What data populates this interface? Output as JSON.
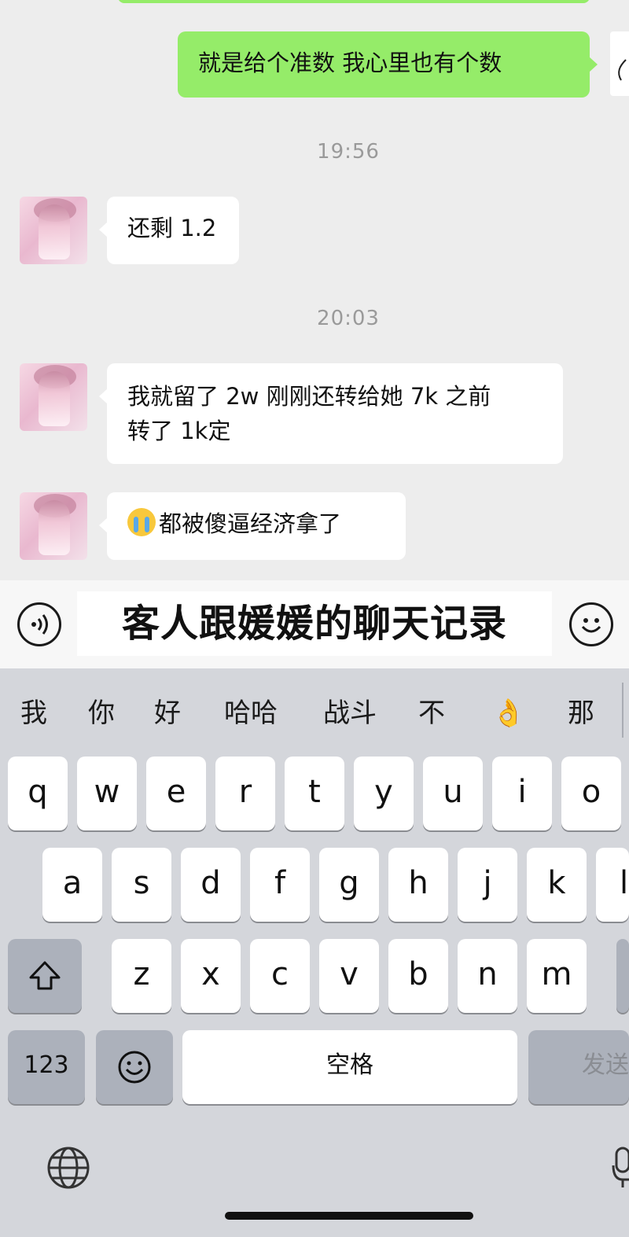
{
  "chat": {
    "messages": [
      {
        "side": "right",
        "text": "就是给个准数 我心里也有个数"
      },
      {
        "type": "time",
        "text": "19:56"
      },
      {
        "side": "left",
        "text": "还剩 1.2"
      },
      {
        "type": "time",
        "text": "20:03"
      },
      {
        "side": "left",
        "text_line1": "我就留了 2w 刚刚还转给她 7k 之前",
        "text_line2": "转了 1k定"
      },
      {
        "side": "left",
        "emoji": "loudly-crying-face",
        "text": "都被傻逼经济拿了"
      }
    ]
  },
  "input_bar": {
    "caption": "客人跟媛媛的聊天记录"
  },
  "keyboard": {
    "candidates": [
      "我",
      "你",
      "好",
      "哈哈",
      "战斗",
      "不",
      "👌",
      "那"
    ],
    "row1": [
      "q",
      "w",
      "e",
      "r",
      "t",
      "y",
      "u",
      "i",
      "o"
    ],
    "row2": [
      "a",
      "s",
      "d",
      "f",
      "g",
      "h",
      "j",
      "k",
      "l"
    ],
    "row3": [
      "z",
      "x",
      "c",
      "v",
      "b",
      "n",
      "m"
    ],
    "numbers_label": "123",
    "space_label": "空格",
    "send_label": "发送"
  },
  "colors": {
    "green_bubble": "#95ec69",
    "chat_bg": "#ededed",
    "keyboard_bg": "#d4d6db"
  }
}
